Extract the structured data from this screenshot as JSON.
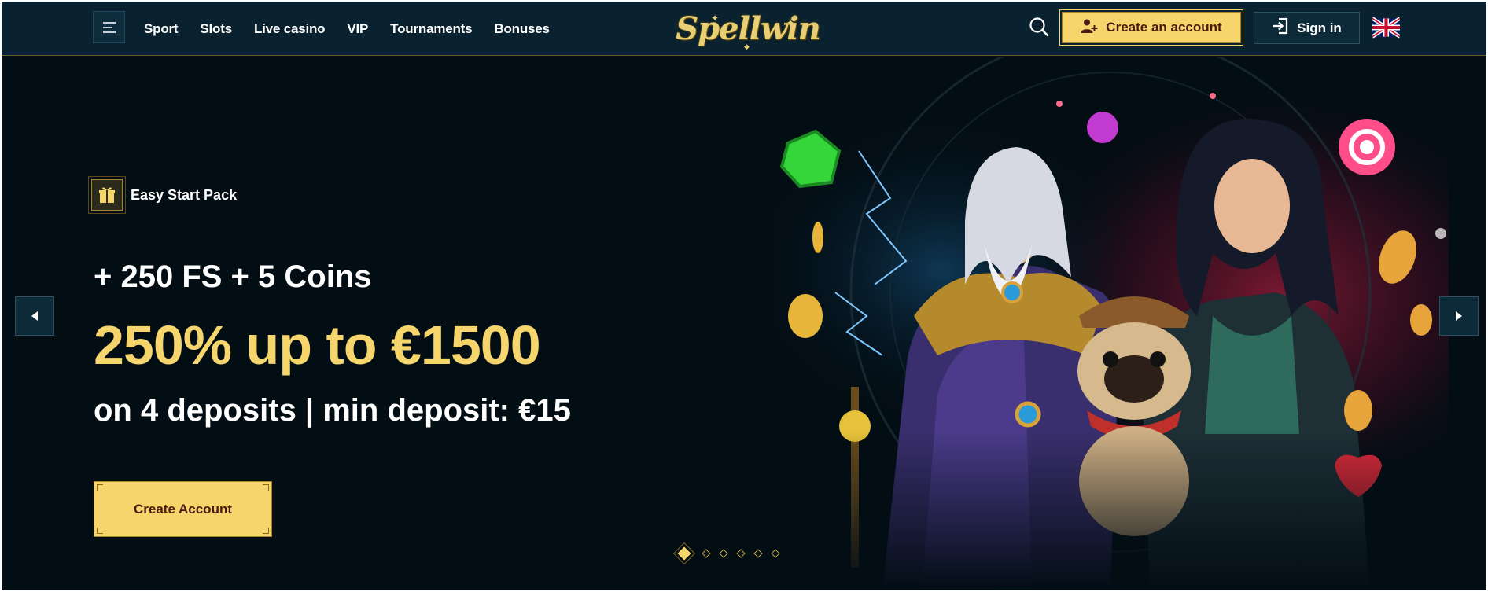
{
  "header": {
    "menu_icon": "hamburger-icon",
    "nav": [
      {
        "label": "Sport"
      },
      {
        "label": "Slots"
      },
      {
        "label": "Live casino"
      },
      {
        "label": "VIP"
      },
      {
        "label": "Tournaments"
      },
      {
        "label": "Bonuses"
      }
    ],
    "logo_text": "Spellwin",
    "search_icon": "search-icon",
    "create_account_label": "Create an account",
    "create_account_icon": "user-plus-icon",
    "sign_in_label": "Sign in",
    "sign_in_icon": "sign-in-icon",
    "language_icon": "uk-flag-icon"
  },
  "hero": {
    "badge_label": "Easy Start Pack",
    "badge_icon": "gift-icon",
    "line1": "+ 250 FS + 5 Coins",
    "line2": "250% up to €1500",
    "line3": "on 4 deposits | min deposit: €15",
    "cta_label": "Create Account",
    "prev_icon": "arrow-left-icon",
    "next_icon": "arrow-right-icon",
    "slides_total": 6,
    "active_slide": 1
  },
  "colors": {
    "background": "#030d14",
    "header_bg": "#0a2230",
    "accent_gold": "#f6d56c",
    "button_text": "#4a1a10"
  }
}
